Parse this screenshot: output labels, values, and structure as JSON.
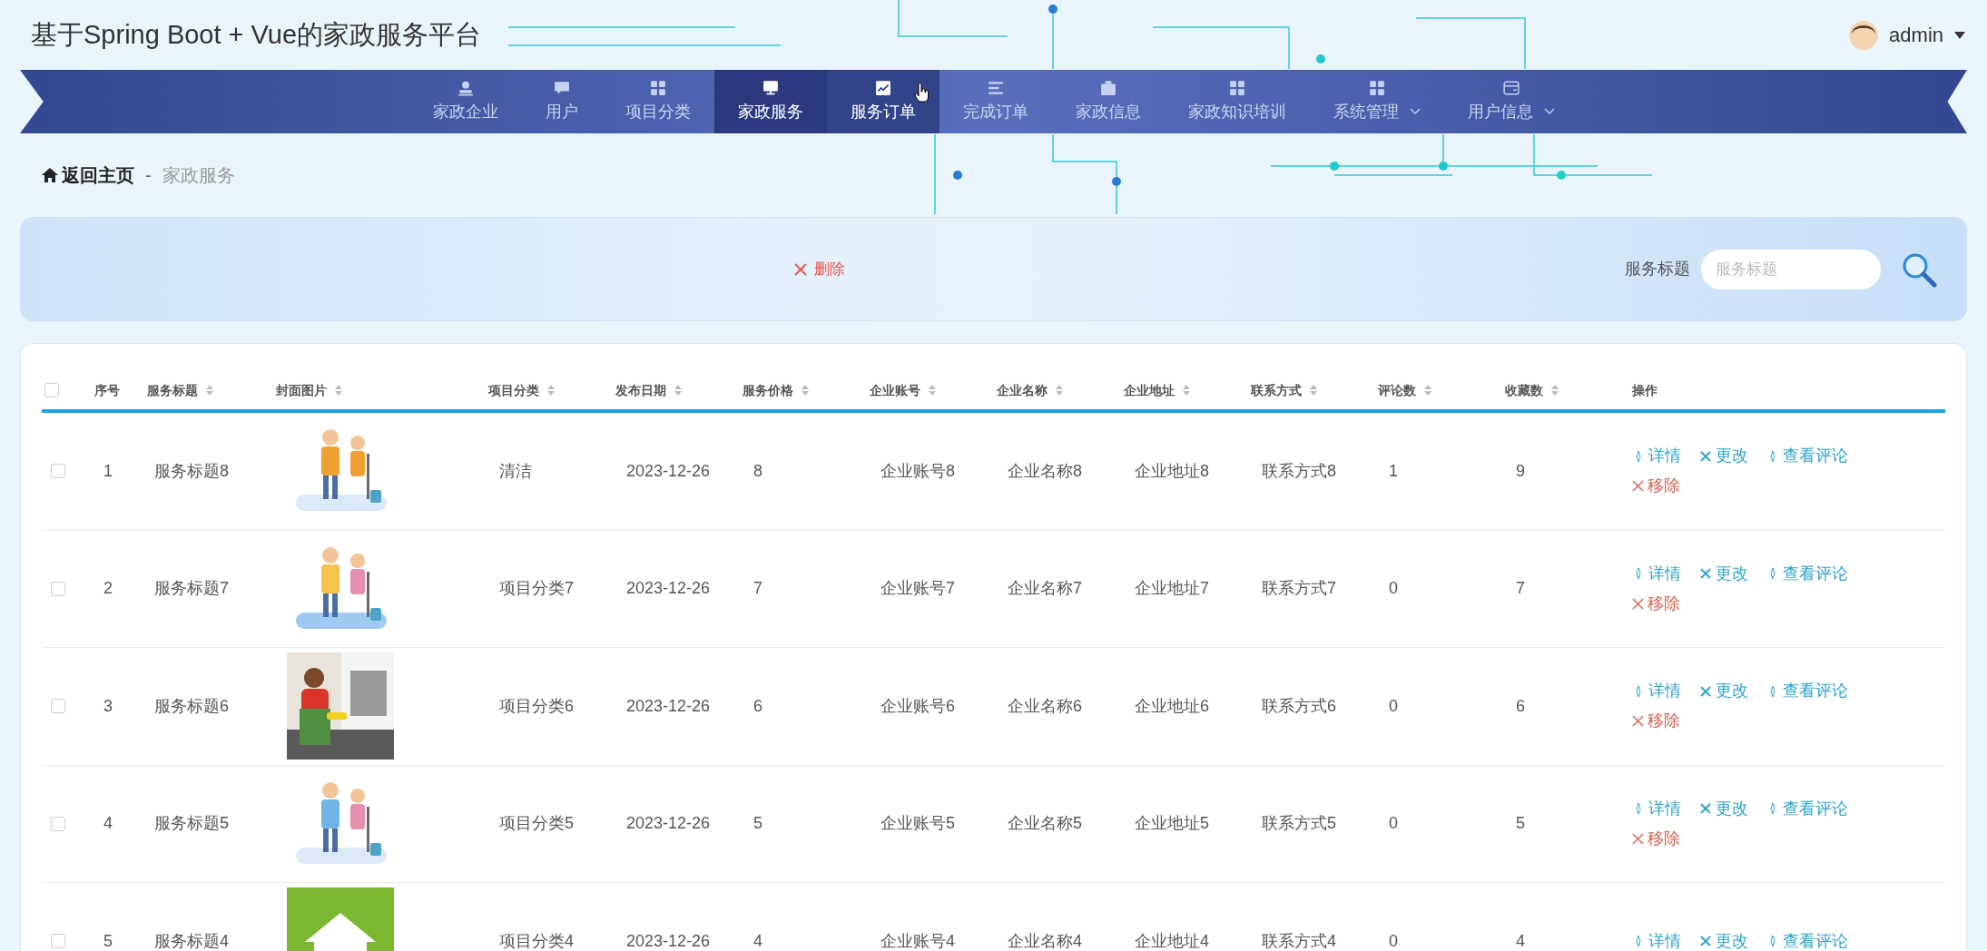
{
  "header": {
    "title": "基于Spring Boot + Vue的家政服务平台",
    "user": "admin"
  },
  "nav": [
    {
      "label": "家政企业",
      "selected": false,
      "highlighted": false,
      "has_menu": false
    },
    {
      "label": "用户",
      "selected": false,
      "highlighted": false,
      "has_menu": false
    },
    {
      "label": "项目分类",
      "selected": false,
      "highlighted": false,
      "has_menu": false
    },
    {
      "label": "家政服务",
      "selected": true,
      "highlighted": false,
      "has_menu": false
    },
    {
      "label": "服务订单",
      "selected": false,
      "highlighted": true,
      "has_menu": false
    },
    {
      "label": "完成订单",
      "selected": false,
      "highlighted": false,
      "has_menu": false
    },
    {
      "label": "家政信息",
      "selected": false,
      "highlighted": false,
      "has_menu": false
    },
    {
      "label": "家政知识培训",
      "selected": false,
      "highlighted": false,
      "has_menu": false
    },
    {
      "label": "系统管理",
      "selected": false,
      "highlighted": false,
      "has_menu": true
    },
    {
      "label": "用户信息",
      "selected": false,
      "highlighted": false,
      "has_menu": true
    }
  ],
  "breadcrumb": {
    "home": "返回主页",
    "separator": "-",
    "current": "家政服务"
  },
  "toolbar": {
    "delete_button": "删除",
    "search_label": "服务标题",
    "search_placeholder": "服务标题"
  },
  "table": {
    "select_all_checked": false,
    "columns": [
      {
        "label": "序号",
        "sortable": false
      },
      {
        "label": "服务标题",
        "sortable": true
      },
      {
        "label": "封面图片",
        "sortable": true
      },
      {
        "label": "项目分类",
        "sortable": true
      },
      {
        "label": "发布日期",
        "sortable": true
      },
      {
        "label": "服务价格",
        "sortable": true
      },
      {
        "label": "企业账号",
        "sortable": true
      },
      {
        "label": "企业名称",
        "sortable": true
      },
      {
        "label": "企业地址",
        "sortable": true
      },
      {
        "label": "联系方式",
        "sortable": true
      },
      {
        "label": "评论数",
        "sortable": true
      },
      {
        "label": "收藏数",
        "sortable": true
      },
      {
        "label": "操作",
        "sortable": false
      }
    ],
    "rows": [
      {
        "checked": false,
        "cells": [
          "1",
          "服务标题8",
          {
            "kind": "picture"
          },
          "清洁",
          "2023-12-26",
          "8",
          "企业账号8",
          "企业名称8",
          "企业地址8",
          "联系方式8",
          "1",
          "9"
        ],
        "actions": [
          "详情",
          "更改",
          "查看评论",
          "移除"
        ]
      },
      {
        "checked": false,
        "cells": [
          "2",
          "服务标题7",
          {
            "kind": "picture"
          },
          "项目分类7",
          "2023-12-26",
          "7",
          "企业账号7",
          "企业名称7",
          "企业地址7",
          "联系方式7",
          "0",
          "7"
        ],
        "actions": [
          "详情",
          "更改",
          "查看评论",
          "移除"
        ]
      },
      {
        "checked": false,
        "cells": [
          "3",
          "服务标题6",
          {
            "kind": "picture"
          },
          "项目分类6",
          "2023-12-26",
          "6",
          "企业账号6",
          "企业名称6",
          "企业地址6",
          "联系方式6",
          "0",
          "6"
        ],
        "actions": [
          "详情",
          "更改",
          "查看评论",
          "移除"
        ]
      },
      {
        "checked": false,
        "cells": [
          "4",
          "服务标题5",
          {
            "kind": "picture"
          },
          "项目分类5",
          "2023-12-26",
          "5",
          "企业账号5",
          "企业名称5",
          "企业地址5",
          "联系方式5",
          "0",
          "5"
        ],
        "actions": [
          "详情",
          "更改",
          "查看评论",
          "移除"
        ]
      },
      {
        "checked": false,
        "cells": [
          "5",
          "服务标题4",
          {
            "kind": "picture"
          },
          "项目分类4",
          "2023-12-26",
          "4",
          "企业账号4",
          "企业名称4",
          "企业地址4",
          "联系方式4",
          "0",
          "4"
        ],
        "actions": [
          "详情",
          "更改",
          "查看评论"
        ]
      }
    ]
  }
}
